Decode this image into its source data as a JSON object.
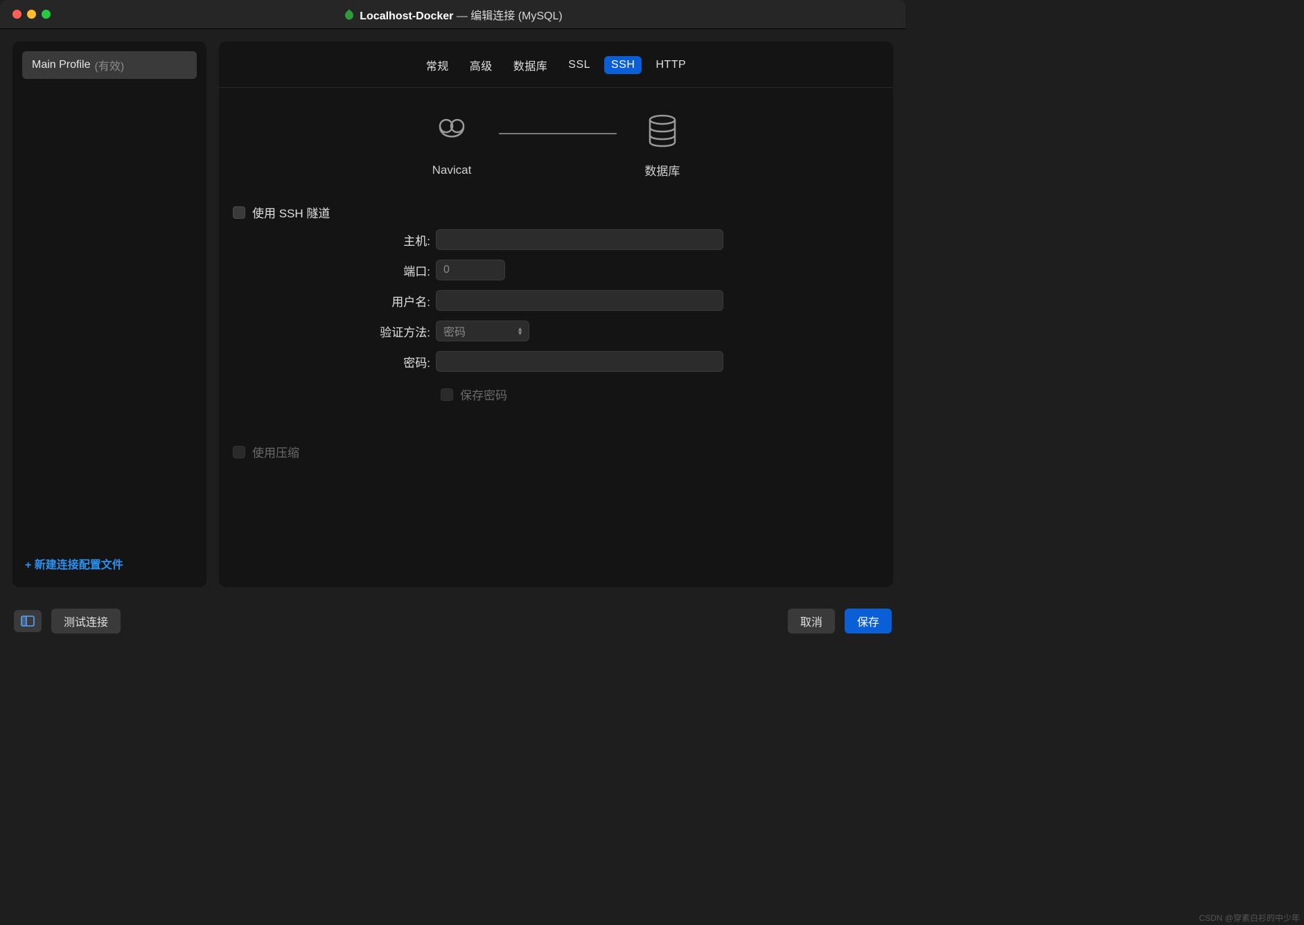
{
  "titlebar": {
    "title_strong": "Localhost-Docker",
    "title_rest": " — 编辑连接 (MySQL)"
  },
  "sidebar": {
    "profile_name": "Main Profile",
    "profile_tag": "(有效)",
    "new_profile_label": "+ 新建连接配置文件"
  },
  "tabs": {
    "general": "常规",
    "advanced": "高级",
    "database": "数据库",
    "ssl": "SSL",
    "ssh": "SSH",
    "http": "HTTP"
  },
  "diagram": {
    "navicat_label": "Navicat",
    "database_label": "数据库"
  },
  "ssh_form": {
    "use_ssh_label": "使用 SSH 隧道",
    "host_label": "主机:",
    "host_value": "",
    "port_label": "端口:",
    "port_value": "0",
    "username_label": "用户名:",
    "username_value": "",
    "auth_label": "验证方法:",
    "auth_value": "密码",
    "password_label": "密码:",
    "password_value": "",
    "save_password_label": "保存密码",
    "use_compression_label": "使用压缩"
  },
  "footer": {
    "test_label": "测试连接",
    "cancel_label": "取消",
    "save_label": "保存"
  },
  "watermark": "CSDN @穿素白衫的中少年"
}
